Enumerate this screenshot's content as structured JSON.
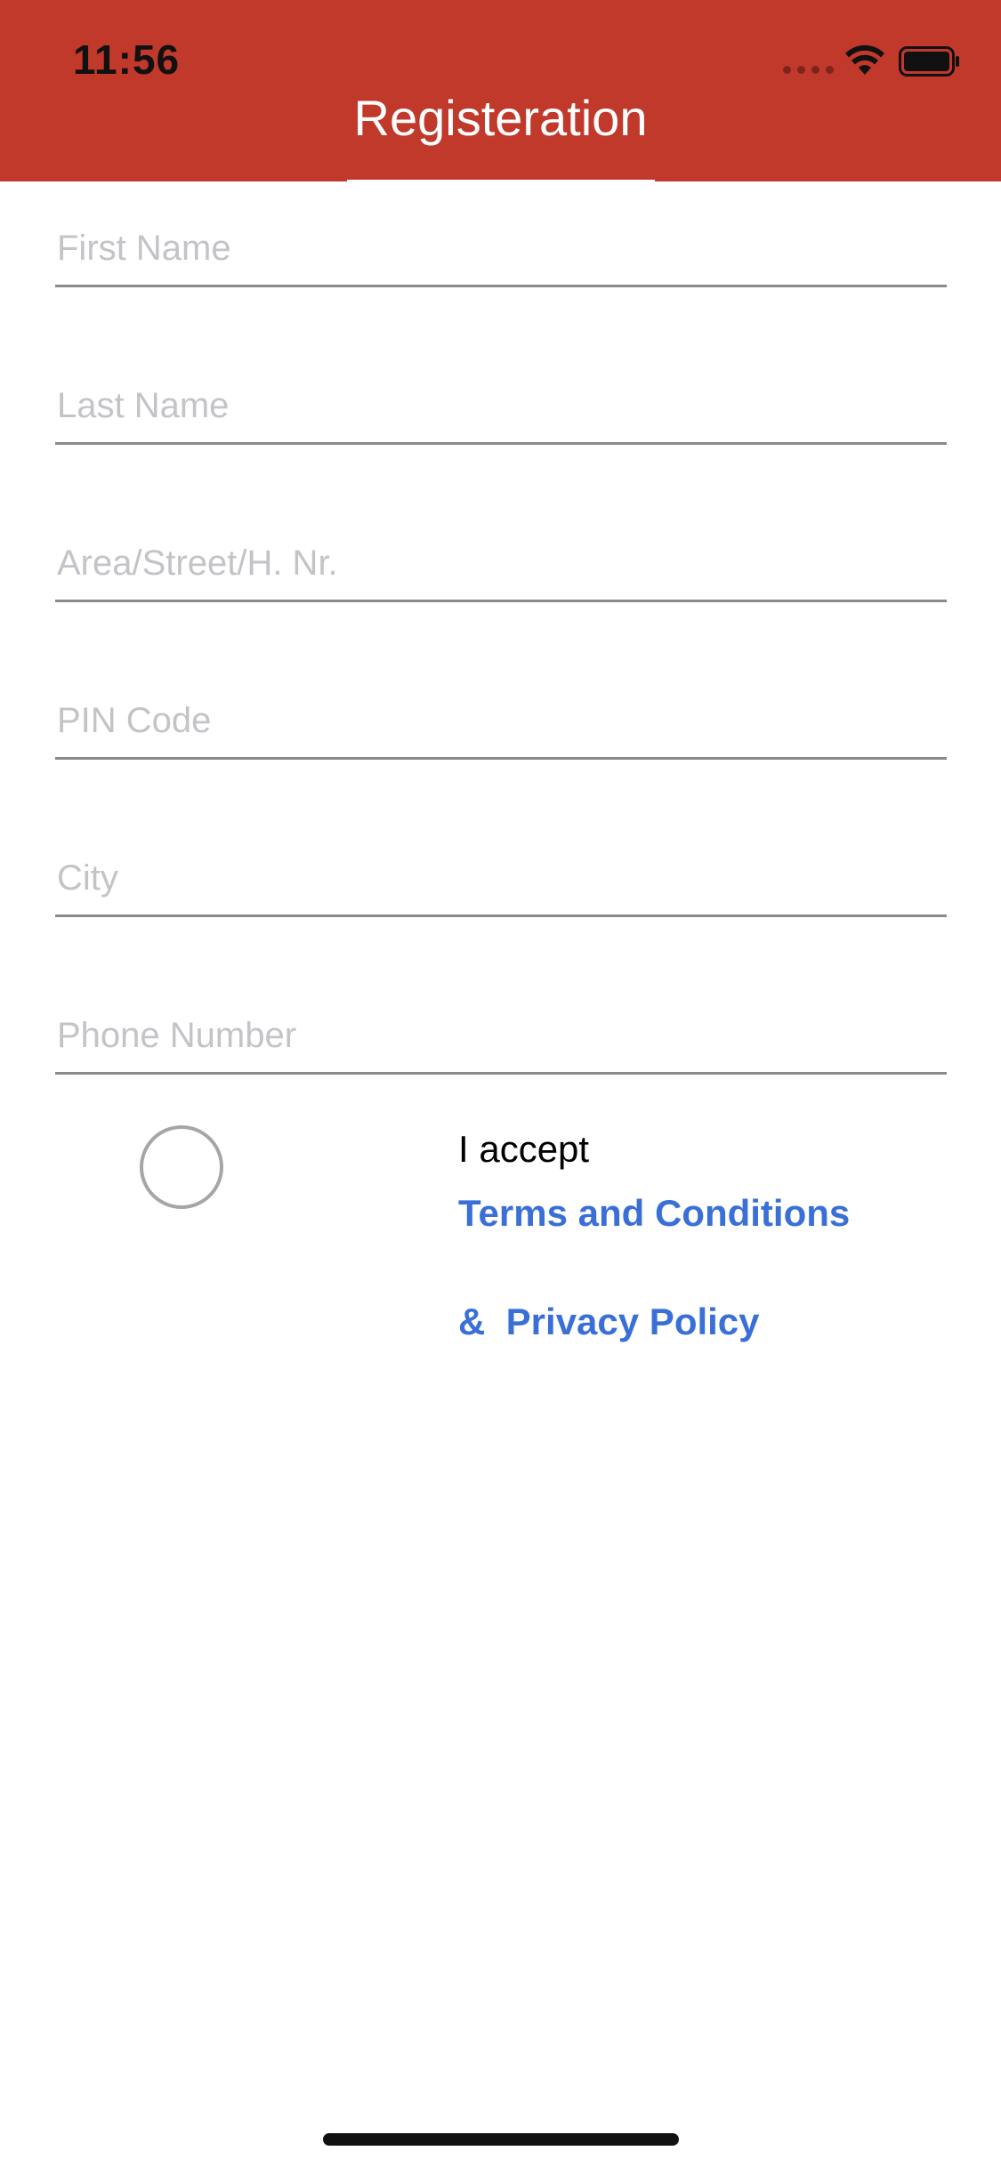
{
  "status_bar": {
    "time": "11:56",
    "icons": [
      "cellular-signal-icon",
      "wifi-icon",
      "battery-icon"
    ]
  },
  "nav": {
    "title": "Registeration"
  },
  "form": {
    "fields": [
      {
        "placeholder": "First Name",
        "value": ""
      },
      {
        "placeholder": "Last Name",
        "value": ""
      },
      {
        "placeholder": "Area/Street/H. Nr.",
        "value": ""
      },
      {
        "placeholder": "PIN Code",
        "value": ""
      },
      {
        "placeholder": "City",
        "value": ""
      },
      {
        "placeholder": "Phone Number",
        "value": ""
      }
    ],
    "accept": {
      "checked": false,
      "label": "I accept",
      "terms_link": "Terms and Conditions",
      "privacy_link": "&  Privacy Policy"
    }
  },
  "colors": {
    "header_bg": "#c0392b",
    "link": "#3b6fd8",
    "placeholder": "#c4c4c8"
  }
}
